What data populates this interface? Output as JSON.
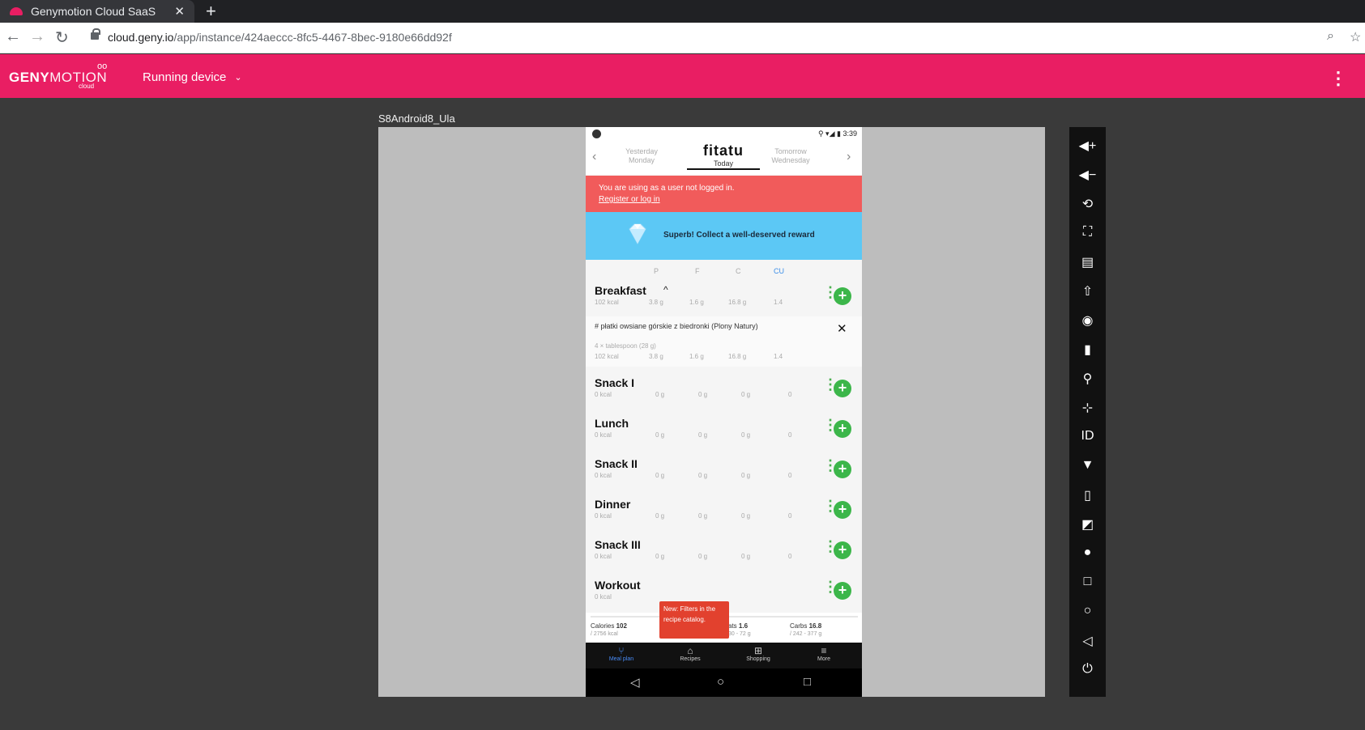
{
  "browser": {
    "tab_title": "Genymotion Cloud SaaS",
    "tab_close": "✕",
    "new_tab": "+",
    "url_host": "cloud.geny.io",
    "url_path": "/app/instance/424aeccc-8fc5-4467-8bec-9180e66dd92f"
  },
  "header": {
    "logo_bold": "GENY",
    "logo_thin": "MOTION",
    "logo_cloud": "cloud",
    "running_label": "Running device"
  },
  "device": {
    "name": "S8Android8_Ula",
    "status_time": "3:39",
    "days": {
      "prev_label": "Yesterday",
      "prev_day": "Monday",
      "app_logo": "fitatu",
      "today": "Today",
      "next_label": "Tomorrow",
      "next_day": "Wednesday"
    },
    "alert": {
      "message": "You are using as a user not logged in.",
      "link": "Register or log in"
    },
    "reward": "Superb! Collect a well-deserved reward",
    "columns": [
      "P",
      "F",
      "C",
      "CU"
    ],
    "meals": [
      {
        "name": "Breakfast",
        "kcal": "102 kcal",
        "p": "3.8 g",
        "f": "1.6 g",
        "c": "16.8 g",
        "cu": "1.4"
      },
      {
        "name": "Snack I",
        "kcal": "0 kcal",
        "p": "0 g",
        "f": "0 g",
        "c": "0 g",
        "cu": "0"
      },
      {
        "name": "Lunch",
        "kcal": "0 kcal",
        "p": "0 g",
        "f": "0 g",
        "c": "0 g",
        "cu": "0"
      },
      {
        "name": "Snack II",
        "kcal": "0 kcal",
        "p": "0 g",
        "f": "0 g",
        "c": "0 g",
        "cu": "0"
      },
      {
        "name": "Dinner",
        "kcal": "0 kcal",
        "p": "0 g",
        "f": "0 g",
        "c": "0 g",
        "cu": "0"
      },
      {
        "name": "Snack III",
        "kcal": "0 kcal",
        "p": "0 g",
        "f": "0 g",
        "c": "0 g",
        "cu": "0"
      },
      {
        "name": "Workout",
        "kcal": "0 kcal"
      }
    ],
    "product": {
      "name": "# płatki owsiane górskie z biedronki (Plony Natury)",
      "serving": "4 × tablespoon (28 g)",
      "kcal": "102 kcal",
      "p": "3.8 g",
      "f": "1.6 g",
      "c": "16.8 g",
      "cu": "1.4"
    },
    "totals": {
      "calories_label": "Calories",
      "calories_value": "102",
      "calories_sub": "/ 2756 kcal",
      "fats_label": "ats",
      "fats_value": "1.6",
      "fats_sub": "30 - 72 g",
      "carbs_label": "Carbs",
      "carbs_value": "16.8",
      "carbs_sub": "/ 242 - 377 g"
    },
    "tooltip": "New: Filters in the recipe catalog.",
    "bottom_nav": [
      "Meal plan",
      "Recipes",
      "Shopping",
      "More"
    ]
  },
  "colors": {
    "brand": "#e91e63",
    "alert": "#f15b5b",
    "reward": "#5cc8f5",
    "add": "#3cb64a"
  }
}
